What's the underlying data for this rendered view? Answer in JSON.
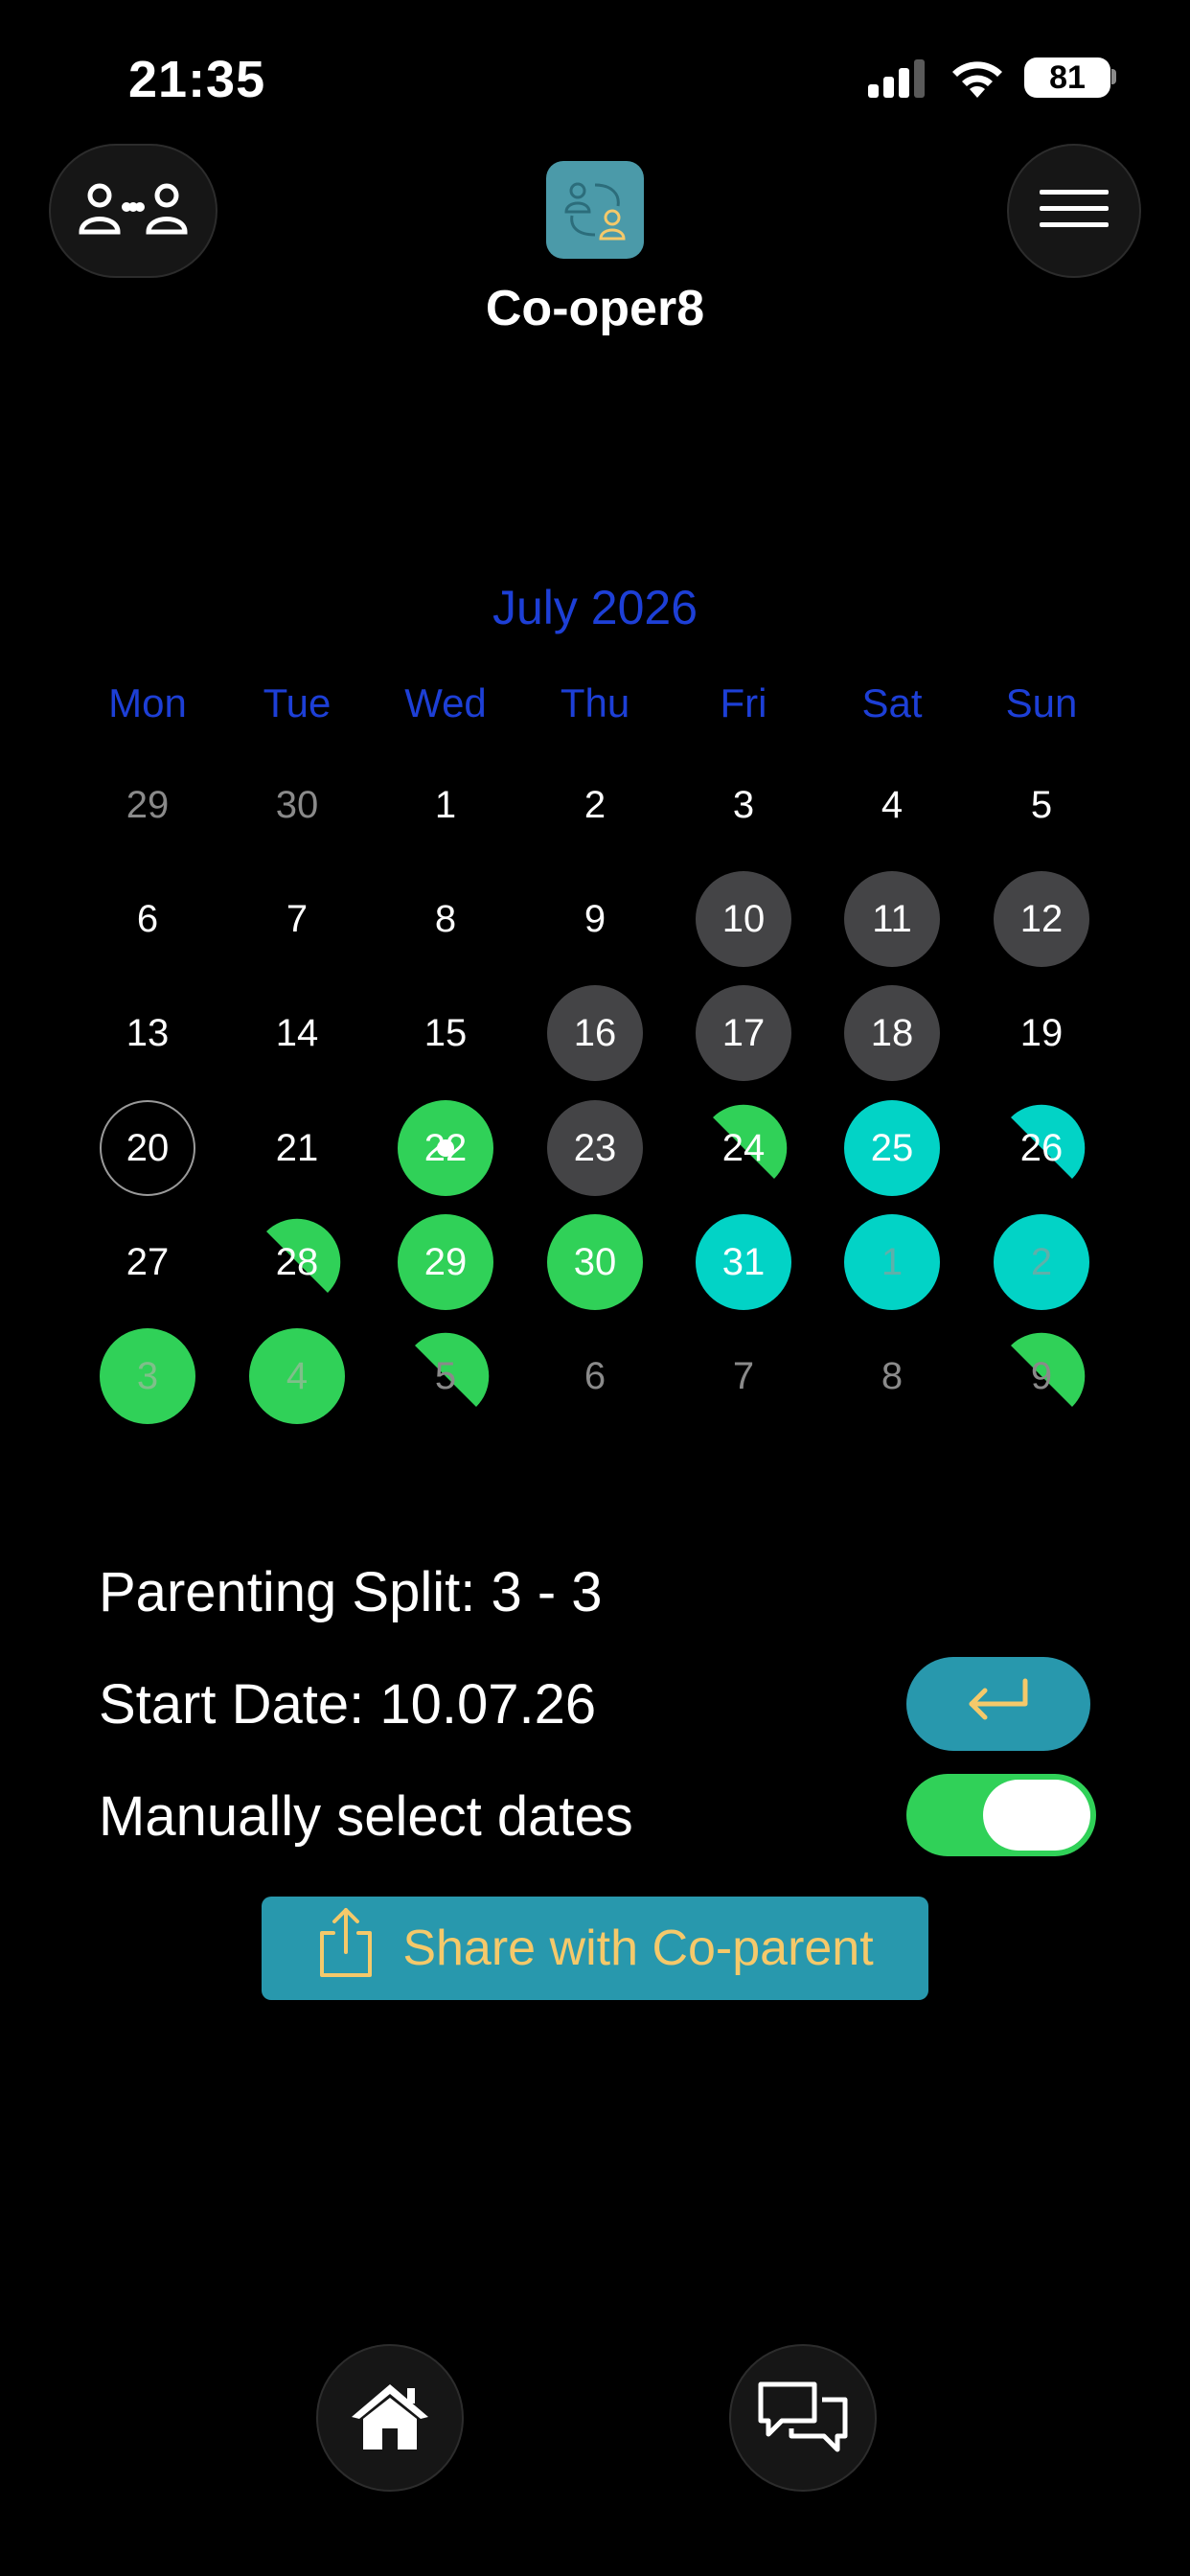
{
  "status_bar": {
    "time": "21:35",
    "battery": "81"
  },
  "header": {
    "app_name": "Co-oper8",
    "logo_icon": "co-parents-logo-icon",
    "left_icon": "co-parents-icon",
    "right_icon": "hamburger-menu-icon"
  },
  "calendar": {
    "month_label": "July 2026",
    "weekdays": [
      "Mon",
      "Tue",
      "Wed",
      "Thu",
      "Fri",
      "Sat",
      "Sun"
    ],
    "weeks": [
      [
        {
          "d": "29",
          "s": "muted"
        },
        {
          "d": "30",
          "s": "muted"
        },
        {
          "d": "1",
          "s": "plain"
        },
        {
          "d": "2",
          "s": "plain"
        },
        {
          "d": "3",
          "s": "plain"
        },
        {
          "d": "4",
          "s": "plain"
        },
        {
          "d": "5",
          "s": "plain"
        }
      ],
      [
        {
          "d": "6",
          "s": "plain"
        },
        {
          "d": "7",
          "s": "plain"
        },
        {
          "d": "8",
          "s": "plain"
        },
        {
          "d": "9",
          "s": "plain"
        },
        {
          "d": "10",
          "s": "grey"
        },
        {
          "d": "11",
          "s": "grey"
        },
        {
          "d": "12",
          "s": "grey"
        }
      ],
      [
        {
          "d": "13",
          "s": "plain"
        },
        {
          "d": "14",
          "s": "plain"
        },
        {
          "d": "15",
          "s": "plain"
        },
        {
          "d": "16",
          "s": "grey"
        },
        {
          "d": "17",
          "s": "grey"
        },
        {
          "d": "18",
          "s": "grey"
        },
        {
          "d": "19",
          "s": "plain"
        }
      ],
      [
        {
          "d": "20",
          "s": "today"
        },
        {
          "d": "21",
          "s": "plain"
        },
        {
          "d": "22",
          "s": "green-dot"
        },
        {
          "d": "23",
          "s": "grey"
        },
        {
          "d": "24",
          "s": "half-green"
        },
        {
          "d": "25",
          "s": "teal"
        },
        {
          "d": "26",
          "s": "half-teal"
        }
      ],
      [
        {
          "d": "27",
          "s": "plain"
        },
        {
          "d": "28",
          "s": "half-green"
        },
        {
          "d": "29",
          "s": "green"
        },
        {
          "d": "30",
          "s": "green"
        },
        {
          "d": "31",
          "s": "teal"
        },
        {
          "d": "1",
          "s": "teal-muted"
        },
        {
          "d": "2",
          "s": "teal-muted"
        }
      ],
      [
        {
          "d": "3",
          "s": "green-muted"
        },
        {
          "d": "4",
          "s": "green-muted"
        },
        {
          "d": "5",
          "s": "half-green-muted"
        },
        {
          "d": "6",
          "s": "muted"
        },
        {
          "d": "7",
          "s": "muted"
        },
        {
          "d": "8",
          "s": "muted"
        },
        {
          "d": "9",
          "s": "half-green-muted"
        }
      ]
    ]
  },
  "info": {
    "split_label": "Parenting Split: 3 - 3",
    "start_label": "Start Date: 10.07.26",
    "manual_label": "Manually select dates",
    "manual_enabled": true
  },
  "share_button": {
    "label": "Share with Co-parent",
    "icon": "share-icon"
  },
  "bottom_nav": {
    "home_icon": "home-icon",
    "chat_icon": "chat-bubbles-icon"
  },
  "colors": {
    "accent_blue": "#1d3fd6",
    "green": "#30d158",
    "teal": "#02d3c6",
    "button_teal": "#2898ad",
    "icon_gold": "#f5c96a"
  }
}
